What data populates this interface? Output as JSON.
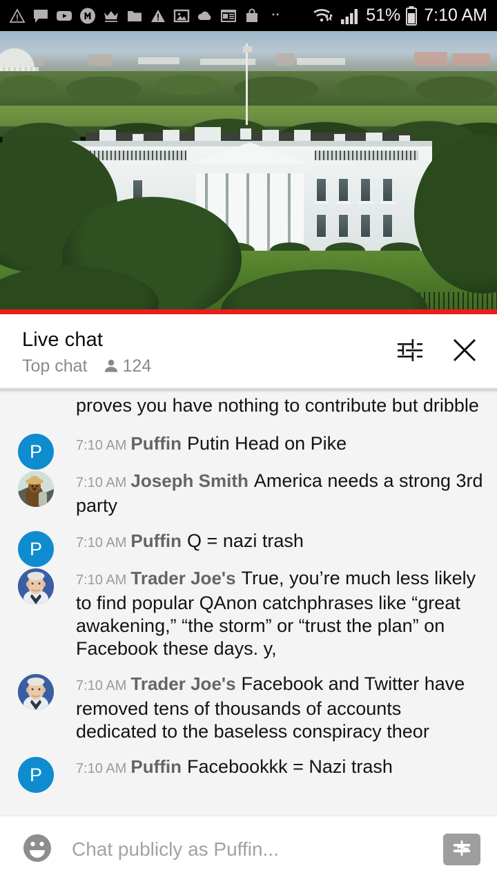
{
  "status_bar": {
    "left_icons": [
      "warning-triangle-icon",
      "chat-bubble-icon",
      "youtube-icon",
      "m-badge-icon",
      "crown-icon",
      "folder-icon",
      "alert-triangle-icon",
      "photo-icon",
      "cloud-icon",
      "news-icon",
      "shopping-bag-icon",
      "more-dots-icon"
    ],
    "wifi_icon": "wifi-transfer-icon",
    "signal_icon": "cell-signal-icon",
    "battery_percent": "51%",
    "battery_icon": "battery-icon",
    "clock": "7:10 AM"
  },
  "video": {
    "description": "White House live stream",
    "progress_color": "#ed1c1c",
    "progress_percent": 100
  },
  "chat_header": {
    "title": "Live chat",
    "mode_label": "Top chat",
    "viewer_icon": "person-icon",
    "viewer_count": "124",
    "settings_icon": "tune-sliders-icon",
    "close_icon": "close-x-icon"
  },
  "messages": [
    {
      "partial": true,
      "avatar_type": "none",
      "avatar_letter": "",
      "timestamp": "",
      "author": "",
      "text": "proves you have nothing to contribute but dribble"
    },
    {
      "partial": false,
      "avatar_type": "letter",
      "avatar_letter": "P",
      "timestamp": "7:10 AM",
      "author": "Puffin",
      "text": "Putin Head on Pike"
    },
    {
      "partial": false,
      "avatar_type": "bear",
      "avatar_letter": "",
      "timestamp": "7:10 AM",
      "author": "Joseph Smith",
      "text": "America needs a strong 3rd party"
    },
    {
      "partial": false,
      "avatar_type": "letter",
      "avatar_letter": "P",
      "timestamp": "7:10 AM",
      "author": "Puffin",
      "text": "Q = nazi trash"
    },
    {
      "partial": false,
      "avatar_type": "photo",
      "avatar_letter": "",
      "timestamp": "7:10 AM",
      "author": "Trader Joe's",
      "text": "True, you’re much less likely to find popular QAnon catchphrases like “great awakening,” “the storm” or “trust the plan” on Facebook these days. y,"
    },
    {
      "partial": false,
      "avatar_type": "photo",
      "avatar_letter": "",
      "timestamp": "7:10 AM",
      "author": "Trader Joe's",
      "text": "Facebook and Twitter have removed tens of thousands of accounts dedicated to the baseless conspiracy theor"
    },
    {
      "partial": false,
      "avatar_type": "letter",
      "avatar_letter": "P",
      "timestamp": "7:10 AM",
      "author": "Puffin",
      "text": "Facebookkk = Nazi trash"
    }
  ],
  "input_bar": {
    "emoji_icon": "emoji-smiley-icon",
    "placeholder": "Chat publicly as Puffin...",
    "value": "",
    "superchat_icon": "dollar-bill-icon"
  },
  "colors": {
    "accent_blue": "#0f8bd0",
    "progress_red": "#ed1c1c",
    "chat_bg": "#f4f4f4",
    "status_bar_bg": "#000000"
  }
}
